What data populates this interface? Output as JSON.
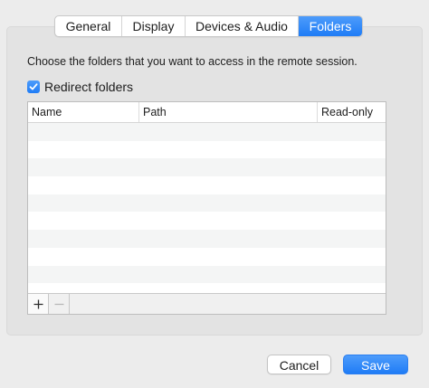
{
  "tabs": [
    {
      "label": "General",
      "selected": false
    },
    {
      "label": "Display",
      "selected": false
    },
    {
      "label": "Devices & Audio",
      "selected": false
    },
    {
      "label": "Folders",
      "selected": true
    }
  ],
  "folders_pane": {
    "description": "Choose the folders that you want to access in the remote session.",
    "redirect_checkbox": {
      "label": "Redirect folders",
      "checked": true
    },
    "table": {
      "columns": [
        "Name",
        "Path",
        "Read-only"
      ],
      "rows": []
    },
    "add_icon": "plus-icon",
    "remove_icon": "minus-icon"
  },
  "buttons": {
    "cancel": "Cancel",
    "save": "Save"
  },
  "colors": {
    "accent": "#1f7cf6"
  }
}
